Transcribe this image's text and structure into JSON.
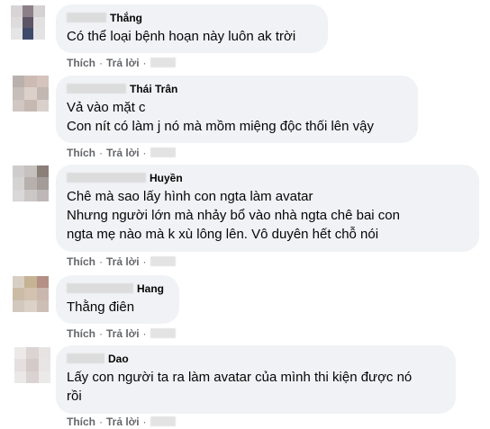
{
  "actions": {
    "like": "Thích",
    "reply": "Trả lời",
    "separator": "·"
  },
  "comments": [
    {
      "name": "Thắng",
      "lines": [
        "Có thể loại bệnh hoạn này luôn ak trời"
      ]
    },
    {
      "name": "Thái Trân",
      "lines": [
        "Vả vào mặt c",
        "Con nít có làm j nó mà mồm miệng độc thối lên vậy"
      ]
    },
    {
      "name": "Huyền",
      "lines": [
        "Chê mà sao lấy hình con ngta làm avatar",
        "Nhưng người lớn mà nhảy bổ vào nhà ngta chê bai con",
        "ngta mẹ nào mà k xù lông lên. Vô duyên hết chỗ nói"
      ]
    },
    {
      "name": "Hang",
      "lines": [
        "Thằng điên"
      ]
    },
    {
      "name": "Dao",
      "lines": [
        "Lấy con người ta ra làm avatar của mình thi kiện được nó",
        "rồi"
      ]
    }
  ]
}
